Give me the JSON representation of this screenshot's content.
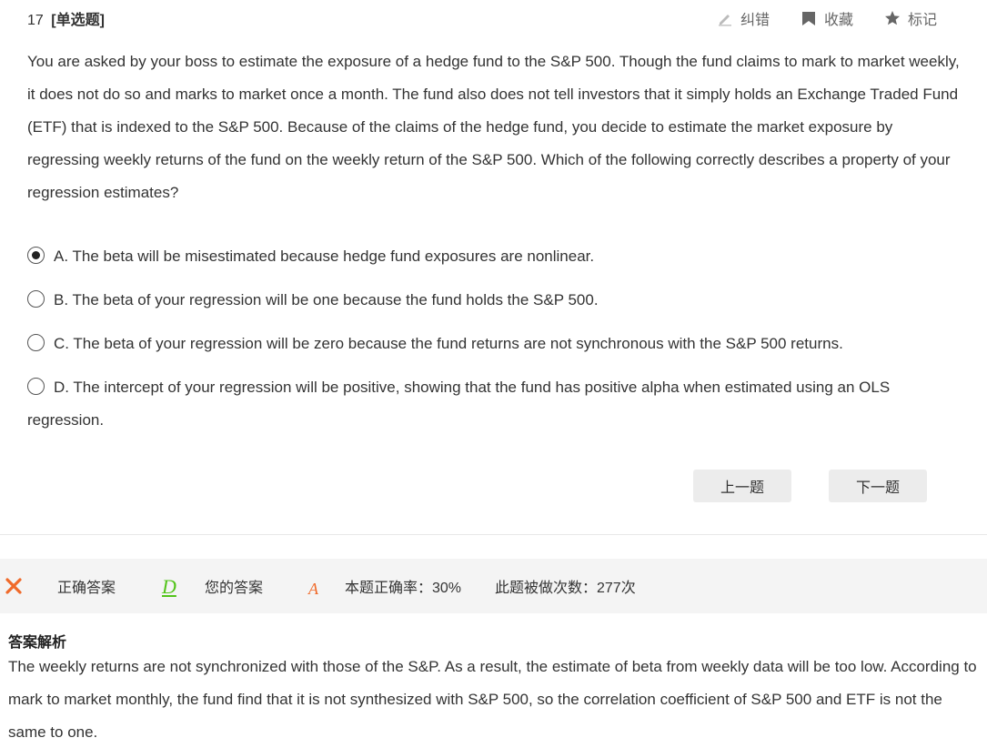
{
  "question": {
    "number": "17",
    "type": "[单选题]",
    "text": "You are asked by your boss to estimate the exposure of a hedge fund to the S&P 500. Though the fund claims to mark to market weekly, it does not do so and marks to market once a month. The fund also does not tell investors that it simply holds an Exchange Traded Fund (ETF) that is indexed to the S&P 500. Because of the claims of the hedge fund, you decide to estimate the market exposure by regressing weekly returns of the fund on the weekly return of the S&P 500. Which of the following correctly describes a property of your regression estimates?"
  },
  "tools": {
    "report": "纠错",
    "favorite": "收藏",
    "mark": "标记"
  },
  "options": [
    {
      "label": "A. The beta will be misestimated because hedge fund exposures are nonlinear.",
      "selected": true
    },
    {
      "label": "B. The beta of your regression will be one because the fund holds the S&P 500.",
      "selected": false
    },
    {
      "label": "C. The beta of your regression will be zero because the fund returns are not synchronous with the S&P 500 returns.",
      "selected": false
    },
    {
      "label": "D. The intercept of your regression will be positive, showing that the fund has positive alpha when estimated using an OLS regression.",
      "selected": false
    }
  ],
  "nav": {
    "prev": "上一题",
    "next": "下一题"
  },
  "result": {
    "correct_label": "正确答案",
    "correct_answer": "D",
    "my_label": "您的答案",
    "my_answer": "A",
    "accuracy": "本题正确率：30%",
    "attempts": "此题被做次数：277次"
  },
  "analysis": {
    "title": "答案解析",
    "text": "The weekly returns are not synchronized with those of the S&P. As a result, the estimate of beta from weekly data will be too low. According to mark to market monthly, the fund find that it is not synthesized with S&P 500, so the correlation coefficient of S&P 500 and ETF is not the same to one."
  },
  "colors": {
    "wrong": "#f06a2a",
    "correct": "#52c41a",
    "result_bg": "#f4f4f4",
    "button_bg": "#ececec"
  },
  "icons": [
    "pencil-icon",
    "bookmark-icon",
    "star-icon",
    "wrong-icon"
  ]
}
